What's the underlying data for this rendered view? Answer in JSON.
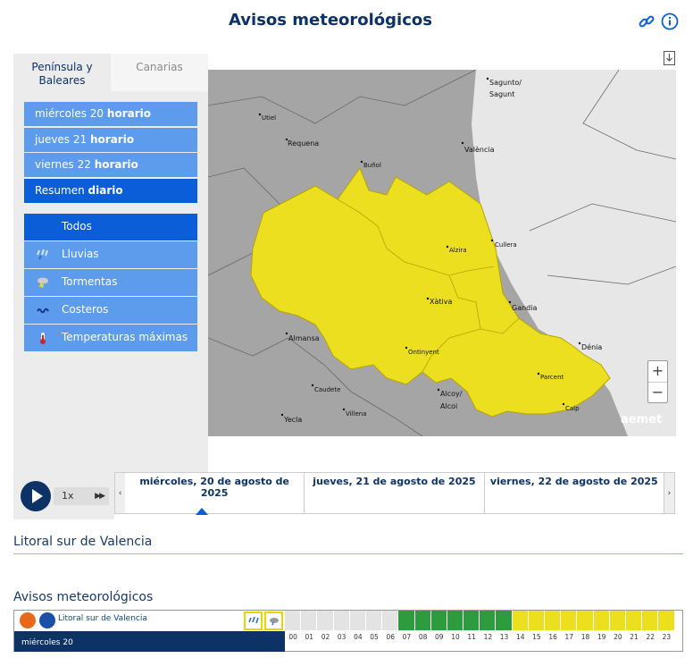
{
  "header": {
    "title": "Avisos meteorológicos"
  },
  "icons": {
    "link": "link-icon",
    "info": "info-icon",
    "download": "download-icon"
  },
  "region_tabs": [
    {
      "label": "Península y Baleares",
      "active": true
    },
    {
      "label": "Canarias",
      "active": false
    }
  ],
  "days": [
    {
      "day": "miércoles 20",
      "suffix": "horario"
    },
    {
      "day": "jueves 21",
      "suffix": "horario"
    },
    {
      "day": "viernes 22",
      "suffix": "horario"
    },
    {
      "day": "Resumen",
      "suffix": "diario",
      "selected": true
    }
  ],
  "warning_types": [
    {
      "label": "Todos",
      "icon": "",
      "selected": true
    },
    {
      "label": "Lluvias",
      "icon": "rain-icon"
    },
    {
      "label": "Tormentas",
      "icon": "storm-icon"
    },
    {
      "label": "Costeros",
      "icon": "waves-icon"
    },
    {
      "label": "Temperaturas máximas",
      "icon": "thermometer-icon"
    }
  ],
  "map": {
    "places": [
      "Sagunto/ Sagunt",
      "Utiel",
      "Requena",
      "València",
      "Buñol",
      "Alzira",
      "Cullera",
      "Xàtiva",
      "Gandia",
      "Almansa",
      "Dénia",
      "Ontinyent",
      "Parcent",
      "Caudete",
      "Alcoy/ Alcoi",
      "Villena",
      "Calp",
      "Yecla"
    ],
    "brand": "aemet",
    "warning_color": "#ecdf1f",
    "zoom_in": "+",
    "zoom_out": "−"
  },
  "player": {
    "speed": "1x",
    "play_icon": "play-icon",
    "ff_icon": "fast-forward-icon"
  },
  "timeline": {
    "dates": [
      "miércoles, 20 de agosto de 2025",
      "jueves, 21 de agosto de 2025",
      "viernes, 22 de agosto de 2025"
    ],
    "prev": "‹",
    "next": "›"
  },
  "zone": {
    "title": "Litoral sur de Valencia"
  },
  "avisos": {
    "title": "Avisos meteorológicos",
    "zone_link": "Litoral sur de Valencia",
    "day_label": "miércoles 20",
    "hours": [
      "00",
      "01",
      "02",
      "03",
      "04",
      "05",
      "06",
      "07",
      "08",
      "09",
      "10",
      "11",
      "12",
      "13",
      "14",
      "15",
      "16",
      "17",
      "18",
      "19",
      "20",
      "21",
      "22",
      "23"
    ],
    "hour_levels": [
      "none",
      "none",
      "none",
      "none",
      "none",
      "none",
      "none",
      "green",
      "green",
      "green",
      "green",
      "green",
      "green",
      "green",
      "yellow",
      "yellow",
      "yellow",
      "yellow",
      "yellow",
      "yellow",
      "yellow",
      "yellow",
      "yellow",
      "yellow"
    ],
    "level_colors": {
      "none": "#e3e3e3",
      "green": "#2e9b3e",
      "yellow": "#ecdf1f"
    }
  }
}
